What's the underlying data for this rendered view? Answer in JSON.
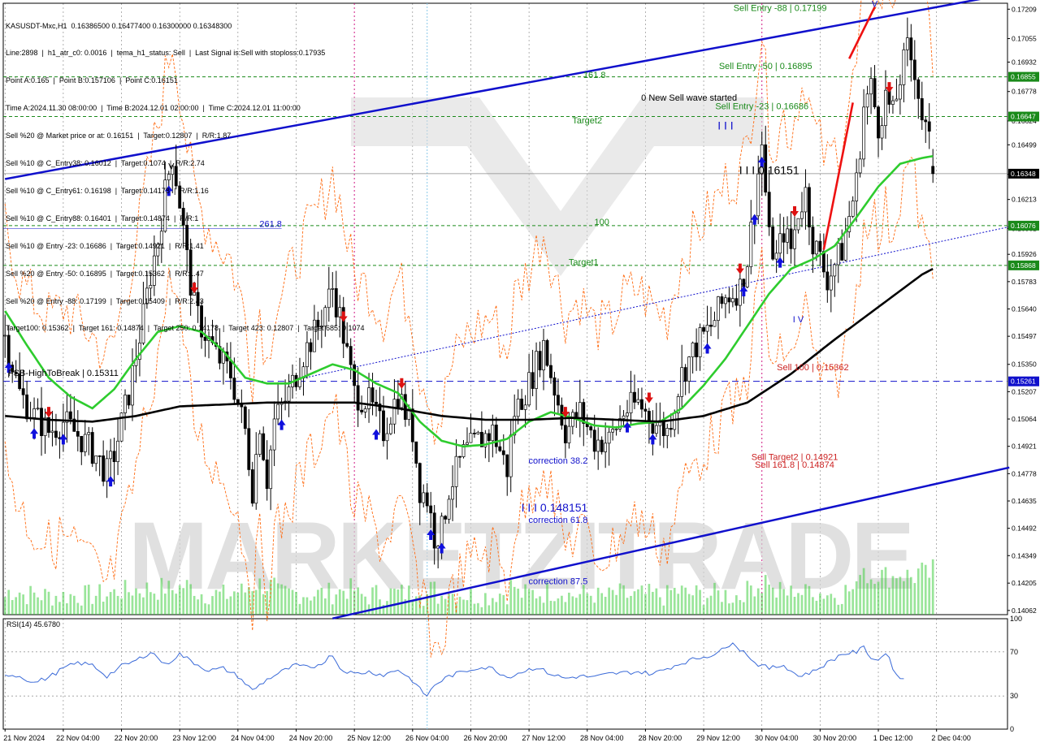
{
  "header_lines": [
    "KASUSDT-Mxc,H1  0.16386500 0.16477400 0.16300000 0.16348300",
    "Line:2898  |  h1_atr_c0: 0.0016  |  tema_h1_status: Sell  |  Last Signal is:Sell with stoploss:0.17935",
    "Point A:0.165  |  Point B:0.157106  |  Point C:0.16151",
    "Time A:2024.11.30 08:00:00  |  Time B:2024.12.01 02:00:00  |  Time C:2024.12.01 11:00:00",
    "Sell %20 @ Market price or at: 0.16151  |  Target:0.12807  |  R/R:1.87",
    "Sell %10 @ C_Entry38: 0.16012  |  Target:0.1074  |  R/R:2.74",
    "Sell %10 @ C_Entry61: 0.16198  |  Target:0.14178  |  R/R:1.16",
    "Sell %10 @ C_Entry88: 0.16401  |  Target:0.14874  |  R/R:1",
    "Sell %10 @ Entry -23: 0.16686  |  Target:0.14921  |  R/R:1.41",
    "Sell %20 @ Entry -50: 0.16895  |  Target:0.15362  |  R/R:1.47",
    "Sell %20 @ Entry -88: 0.17199  |  Target:0.15409  |  R/R:2.43",
    "Target100: 0.15362  |  Target 161: 0.14874  |  Target 250: 0.14178  |  Target 423: 0.12807  |  Target 685: 0.1074"
  ],
  "colors": {
    "candle": "#000000",
    "tema_fast": "#2ecc2e",
    "ma_slow": "#000000",
    "channel": "#1010cc",
    "bands": "#ff6a10",
    "level_green": "#1a8a1a",
    "level_blue": "#1010cc",
    "volume": "#33cc33",
    "rsi_line": "#3a6ad8",
    "price_tag_bg": "#000000",
    "green_tag_bg": "#1a8a1a",
    "blue_tag_bg": "#1010cc",
    "session_line": "#cc0077"
  },
  "chart_data": {
    "type": "candlestick",
    "symbol": "KASUSDT-Mxc",
    "timeframe": "H1",
    "ohlc_last": {
      "open": 0.163865,
      "high": 0.164774,
      "low": 0.163,
      "close": 0.163483
    },
    "ylim": [
      0.1404,
      0.1724
    ],
    "y_ticks": [
      0.17209,
      0.17055,
      0.16932,
      0.16778,
      0.16624,
      0.16499,
      0.16345,
      0.16213,
      0.16061,
      0.15926,
      0.15783,
      0.1564,
      0.15497,
      0.1535,
      0.15207,
      0.15064,
      0.14921,
      0.14778,
      0.14635,
      0.14492,
      0.14349,
      0.14205,
      0.14062
    ],
    "y_tick_labels": [
      "0.17209",
      "0.17055",
      "0.16932",
      "0.16778",
      "0.16624",
      "0.16499",
      "0.16345",
      "0.16213",
      "0.16061",
      "0.15926",
      "0.15783",
      "0.15640",
      "0.15497",
      "0.15350",
      "0.15207",
      "0.15064",
      "0.14921",
      "0.14778",
      "0.14635",
      "0.14492",
      "0.14349",
      "0.14205",
      "0.14062"
    ],
    "price_tags": [
      {
        "value": 0.16855,
        "label": "0.16855",
        "kind": "green"
      },
      {
        "value": 0.16647,
        "label": "0.16647",
        "kind": "green"
      },
      {
        "value": 0.16348,
        "label": "0.16348",
        "kind": "price"
      },
      {
        "value": 0.16076,
        "label": "0.16076",
        "kind": "green"
      },
      {
        "value": 0.15868,
        "label": "0.15868",
        "kind": "green"
      },
      {
        "value": 0.15261,
        "label": "0.15261",
        "kind": "blue"
      }
    ],
    "x_labels": [
      "21 Nov 2024",
      "22 Nov 04:00",
      "22 Nov 20:00",
      "23 Nov 12:00",
      "24 Nov 04:00",
      "24 Nov 20:00",
      "25 Nov 12:00",
      "26 Nov 04:00",
      "26 Nov 20:00",
      "27 Nov 12:00",
      "28 Nov 04:00",
      "28 Nov 20:00",
      "29 Nov 12:00",
      "30 Nov 04:00",
      "30 Nov 20:00",
      "1 Dec 12:00",
      "2 Dec 04:00"
    ],
    "x_label_bars": [
      0,
      16,
      32,
      48,
      64,
      80,
      96,
      112,
      128,
      144,
      160,
      176,
      192,
      208,
      224,
      240,
      256
    ],
    "bars_total": 276,
    "levels": [
      {
        "value": 0.16855,
        "style": "green-dashed"
      },
      {
        "value": 0.16647,
        "style": "green-dashed"
      },
      {
        "value": 0.16076,
        "style": "green-dashed"
      },
      {
        "value": 0.15868,
        "style": "green-dashed"
      },
      {
        "value": 0.15261,
        "style": "blue-dashed"
      },
      {
        "value": 0.16348,
        "style": "gray-solid"
      },
      {
        "value": 0.1606,
        "style": "blue-solid-thin"
      }
    ],
    "close_path": [
      [
        0,
        0.155
      ],
      [
        4,
        0.152
      ],
      [
        8,
        0.1508
      ],
      [
        12,
        0.15
      ],
      [
        16,
        0.1505
      ],
      [
        20,
        0.1498
      ],
      [
        24,
        0.149
      ],
      [
        28,
        0.1478
      ],
      [
        30,
        0.1488
      ],
      [
        34,
        0.152
      ],
      [
        38,
        0.156
      ],
      [
        40,
        0.1582
      ],
      [
        42,
        0.16
      ],
      [
        44,
        0.1625
      ],
      [
        46,
        0.1645
      ],
      [
        48,
        0.162
      ],
      [
        50,
        0.159
      ],
      [
        52,
        0.1565
      ],
      [
        54,
        0.1555
      ],
      [
        58,
        0.154
      ],
      [
        62,
        0.153
      ],
      [
        66,
        0.15
      ],
      [
        68,
        0.147
      ],
      [
        70,
        0.1505
      ],
      [
        72,
        0.1475
      ],
      [
        74,
        0.1505
      ],
      [
        78,
        0.152
      ],
      [
        82,
        0.154
      ],
      [
        86,
        0.1555
      ],
      [
        90,
        0.1575
      ],
      [
        92,
        0.156
      ],
      [
        94,
        0.154
      ],
      [
        96,
        0.152
      ],
      [
        100,
        0.1515
      ],
      [
        104,
        0.15
      ],
      [
        108,
        0.152
      ],
      [
        112,
        0.15
      ],
      [
        114,
        0.147
      ],
      [
        116,
        0.1465
      ],
      [
        118,
        0.1445
      ],
      [
        120,
        0.1448
      ],
      [
        122,
        0.147
      ],
      [
        126,
        0.1488
      ],
      [
        130,
        0.1495
      ],
      [
        134,
        0.15
      ],
      [
        138,
        0.148
      ],
      [
        140,
        0.151
      ],
      [
        144,
        0.1525
      ],
      [
        148,
        0.1545
      ],
      [
        150,
        0.153
      ],
      [
        154,
        0.15
      ],
      [
        158,
        0.151
      ],
      [
        162,
        0.1495
      ],
      [
        166,
        0.1495
      ],
      [
        170,
        0.151
      ],
      [
        174,
        0.1515
      ],
      [
        178,
        0.1505
      ],
      [
        182,
        0.15
      ],
      [
        186,
        0.153
      ],
      [
        190,
        0.1545
      ],
      [
        194,
        0.1555
      ],
      [
        198,
        0.157
      ],
      [
        202,
        0.1575
      ],
      [
        204,
        0.159
      ],
      [
        206,
        0.162
      ],
      [
        208,
        0.165
      ],
      [
        210,
        0.16
      ],
      [
        212,
        0.159
      ],
      [
        214,
        0.1605
      ],
      [
        216,
        0.1595
      ],
      [
        218,
        0.1615
      ],
      [
        220,
        0.1625
      ],
      [
        222,
        0.16
      ],
      [
        226,
        0.158
      ],
      [
        230,
        0.1595
      ],
      [
        234,
        0.163
      ],
      [
        236,
        0.167
      ],
      [
        238,
        0.168
      ],
      [
        240,
        0.166
      ],
      [
        242,
        0.1675
      ],
      [
        244,
        0.1665
      ],
      [
        246,
        0.1685
      ],
      [
        248,
        0.17
      ],
      [
        250,
        0.169
      ],
      [
        252,
        0.1665
      ],
      [
        254,
        0.165
      ],
      [
        255,
        0.16348
      ]
    ],
    "tema_path": [
      [
        0,
        0.1563
      ],
      [
        6,
        0.1545
      ],
      [
        12,
        0.1528
      ],
      [
        18,
        0.1518
      ],
      [
        24,
        0.1512
      ],
      [
        30,
        0.1522
      ],
      [
        36,
        0.1538
      ],
      [
        42,
        0.1552
      ],
      [
        48,
        0.1555
      ],
      [
        54,
        0.1552
      ],
      [
        60,
        0.1542
      ],
      [
        66,
        0.1528
      ],
      [
        72,
        0.1525
      ],
      [
        78,
        0.1525
      ],
      [
        84,
        0.153
      ],
      [
        90,
        0.1535
      ],
      [
        96,
        0.1532
      ],
      [
        102,
        0.1525
      ],
      [
        108,
        0.152
      ],
      [
        114,
        0.1505
      ],
      [
        120,
        0.1495
      ],
      [
        126,
        0.1492
      ],
      [
        132,
        0.1493
      ],
      [
        138,
        0.1496
      ],
      [
        144,
        0.1505
      ],
      [
        150,
        0.151
      ],
      [
        156,
        0.1507
      ],
      [
        162,
        0.1503
      ],
      [
        168,
        0.1502
      ],
      [
        174,
        0.1504
      ],
      [
        180,
        0.1505
      ],
      [
        186,
        0.1512
      ],
      [
        192,
        0.1524
      ],
      [
        198,
        0.1538
      ],
      [
        204,
        0.1555
      ],
      [
        210,
        0.1572
      ],
      [
        216,
        0.1585
      ],
      [
        222,
        0.159
      ],
      [
        228,
        0.1597
      ],
      [
        234,
        0.1612
      ],
      [
        240,
        0.1628
      ],
      [
        246,
        0.164
      ],
      [
        252,
        0.1643
      ],
      [
        255,
        0.1644
      ]
    ],
    "ma_path": [
      [
        0,
        0.1508
      ],
      [
        12,
        0.1506
      ],
      [
        24,
        0.1505
      ],
      [
        36,
        0.1508
      ],
      [
        48,
        0.1513
      ],
      [
        60,
        0.1514
      ],
      [
        72,
        0.1515
      ],
      [
        84,
        0.1515
      ],
      [
        96,
        0.1515
      ],
      [
        108,
        0.1512
      ],
      [
        120,
        0.1508
      ],
      [
        132,
        0.1506
      ],
      [
        144,
        0.1506
      ],
      [
        156,
        0.1507
      ],
      [
        168,
        0.1506
      ],
      [
        180,
        0.1505
      ],
      [
        192,
        0.1508
      ],
      [
        204,
        0.1515
      ],
      [
        216,
        0.153
      ],
      [
        228,
        0.1548
      ],
      [
        240,
        0.1565
      ],
      [
        252,
        0.1582
      ],
      [
        255,
        0.1585
      ]
    ],
    "channel_upper": [
      [
        0,
        0.1632
      ],
      [
        276,
        0.1729
      ]
    ],
    "channel_lower": [
      [
        90,
        0.1402
      ],
      [
        276,
        0.1481
      ]
    ],
    "channel_mid_dotted": [
      [
        80,
        0.1527
      ],
      [
        276,
        0.1607
      ]
    ],
    "annotations": [
      {
        "text": "Sell Entry -88 | 0.17199",
        "bar": 213,
        "value": 0.17199,
        "color": "#1a8a1a"
      },
      {
        "text": "Sell Entry -50 | 0.16895",
        "bar": 209,
        "value": 0.16895,
        "color": "#1a8a1a"
      },
      {
        "text": "Sell Entry -23 | 0.16686",
        "bar": 208,
        "value": 0.16686,
        "color": "#1a8a1a"
      },
      {
        "text": "0 New Sell wave started",
        "bar": 188,
        "value": 0.1673,
        "color": "#000000"
      },
      {
        "text": "161.8",
        "bar": 162,
        "value": 0.1685,
        "color": "#1a8a1a"
      },
      {
        "text": "Target2",
        "bar": 160,
        "value": 0.1661,
        "color": "#1a8a1a"
      },
      {
        "text": "100",
        "bar": 164,
        "value": 0.1608,
        "color": "#1a8a1a"
      },
      {
        "text": "Target1",
        "bar": 159,
        "value": 0.1587,
        "color": "#1a8a1a"
      },
      {
        "text": "261.8",
        "bar": 73,
        "value": 0.1607,
        "color": "#1010cc"
      },
      {
        "text": "I I I 0.16151",
        "bar": 210,
        "value": 0.16345,
        "color": "#000000"
      },
      {
        "text": "I I I",
        "bar": 198,
        "value": 0.1658,
        "color": "#1010cc"
      },
      {
        "text": "I V",
        "bar": 218,
        "value": 0.1557,
        "color": "#1010cc"
      },
      {
        "text": "Sell 100 | 0.15362",
        "bar": 222,
        "value": 0.1532,
        "color": "#cc2222"
      },
      {
        "text": "FSB-HighToBreak | 0.15311",
        "bar": 16,
        "value": 0.1529,
        "color": "#000000"
      },
      {
        "text": "correction 38.2",
        "bar": 152,
        "value": 0.1483,
        "color": "#1010cc"
      },
      {
        "text": "I I I 0.148151",
        "bar": 151,
        "value": 0.1458,
        "color": "#1010cc"
      },
      {
        "text": "correction 61.8",
        "bar": 152,
        "value": 0.1452,
        "color": "#1010cc"
      },
      {
        "text": "correction 87.5",
        "bar": 152,
        "value": 0.142,
        "color": "#1010cc"
      },
      {
        "text": "Sell Target2 | 0.14921",
        "bar": 217,
        "value": 0.1485,
        "color": "#cc2222"
      },
      {
        "text": "Sell 161.8 | 0.14874",
        "bar": 217,
        "value": 0.1481,
        "color": "#cc2222"
      },
      {
        "text": "I V",
        "bar": 45,
        "value": 0.1637,
        "color": "#000000"
      },
      {
        "text": "V",
        "bar": 239,
        "value": 0.1722,
        "color": "#1010cc"
      }
    ],
    "blue_arrow_bars": [
      1,
      8,
      16,
      29,
      45,
      76,
      102,
      117,
      120,
      171,
      178,
      193,
      203,
      206,
      208,
      213
    ],
    "red_arrow_bars": [
      12,
      52,
      93,
      109,
      154,
      177,
      202,
      217,
      243
    ],
    "watermark": "MARKETZITRADE",
    "rsi": {
      "label": "RSI(14) 45.6780",
      "ylim": [
        0,
        100
      ],
      "ticks": [
        100,
        70,
        30,
        0
      ],
      "levels": [
        70,
        30
      ],
      "values": [
        [
          0,
          50
        ],
        [
          4,
          48
        ],
        [
          8,
          42
        ],
        [
          12,
          47
        ],
        [
          16,
          55
        ],
        [
          20,
          60
        ],
        [
          24,
          58
        ],
        [
          28,
          48
        ],
        [
          32,
          57
        ],
        [
          36,
          62
        ],
        [
          40,
          70
        ],
        [
          42,
          65
        ],
        [
          44,
          58
        ],
        [
          48,
          68
        ],
        [
          52,
          60
        ],
        [
          56,
          53
        ],
        [
          60,
          55
        ],
        [
          64,
          48
        ],
        [
          68,
          35
        ],
        [
          72,
          45
        ],
        [
          76,
          52
        ],
        [
          80,
          58
        ],
        [
          84,
          55
        ],
        [
          88,
          62
        ],
        [
          90,
          68
        ],
        [
          92,
          55
        ],
        [
          96,
          50
        ],
        [
          100,
          52
        ],
        [
          104,
          49
        ],
        [
          108,
          54
        ],
        [
          112,
          44
        ],
        [
          114,
          36
        ],
        [
          116,
          30
        ],
        [
          118,
          40
        ],
        [
          122,
          48
        ],
        [
          126,
          52
        ],
        [
          130,
          56
        ],
        [
          134,
          55
        ],
        [
          138,
          47
        ],
        [
          142,
          52
        ],
        [
          146,
          56
        ],
        [
          150,
          50
        ],
        [
          154,
          46
        ],
        [
          158,
          48
        ],
        [
          162,
          47
        ],
        [
          166,
          50
        ],
        [
          170,
          51
        ],
        [
          174,
          52
        ],
        [
          178,
          50
        ],
        [
          182,
          55
        ],
        [
          186,
          60
        ],
        [
          190,
          64
        ],
        [
          194,
          67
        ],
        [
          198,
          73
        ],
        [
          200,
          80
        ],
        [
          202,
          72
        ],
        [
          204,
          68
        ],
        [
          206,
          60
        ],
        [
          210,
          55
        ],
        [
          214,
          58
        ],
        [
          218,
          48
        ],
        [
          222,
          52
        ],
        [
          226,
          60
        ],
        [
          230,
          68
        ],
        [
          234,
          70
        ],
        [
          236,
          74
        ],
        [
          238,
          65
        ],
        [
          240,
          62
        ],
        [
          242,
          70
        ],
        [
          244,
          56
        ],
        [
          246,
          45
        ],
        [
          247,
          46
        ]
      ]
    }
  }
}
